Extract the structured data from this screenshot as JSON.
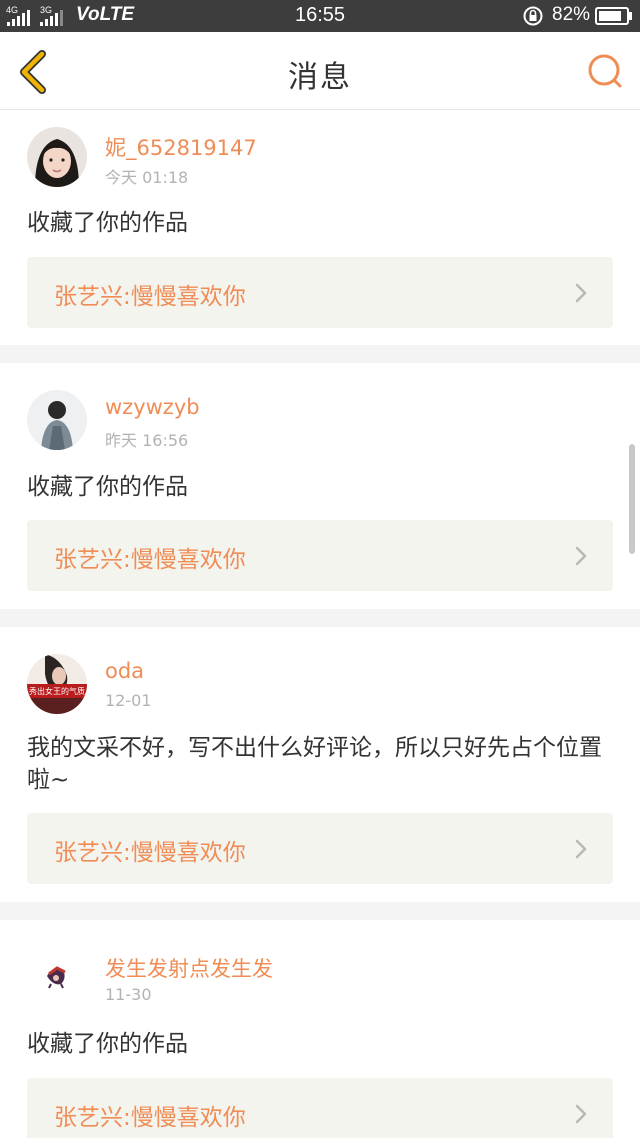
{
  "status_bar": {
    "net_left": "4G",
    "net_right": "3G",
    "volte": "VoLTE",
    "time": "16:55",
    "battery": "82%"
  },
  "header": {
    "title": "消息",
    "back_icon": "chevron-left-icon",
    "search_icon": "search-icon"
  },
  "messages": [
    {
      "username": "妮_652819147",
      "time": "今天 01:18",
      "text": "收藏了你的作品",
      "work": "张艺兴:慢慢喜欢你"
    },
    {
      "username": "wzywzyb",
      "time": "昨天 16:56",
      "text": "收藏了你的作品",
      "work": "张艺兴:慢慢喜欢你"
    },
    {
      "username": "oda",
      "time": "12-01",
      "text": "我的文采不好，写不出什么好评论，所以只好先占个位置啦~",
      "work": "张艺兴:慢慢喜欢你",
      "avatar_caption": "秀出女王的气质"
    },
    {
      "username": "发生发射点发生发",
      "time": "11-30",
      "text": "收藏了你的作品",
      "work": "张艺兴:慢慢喜欢你"
    }
  ],
  "colors": {
    "accent": "#f08c55",
    "back_arrow": "#f0b400",
    "status_bar_bg": "#3d3d3d",
    "ref_bg": "#f4f4ef",
    "separator": "#f4f4f4"
  }
}
